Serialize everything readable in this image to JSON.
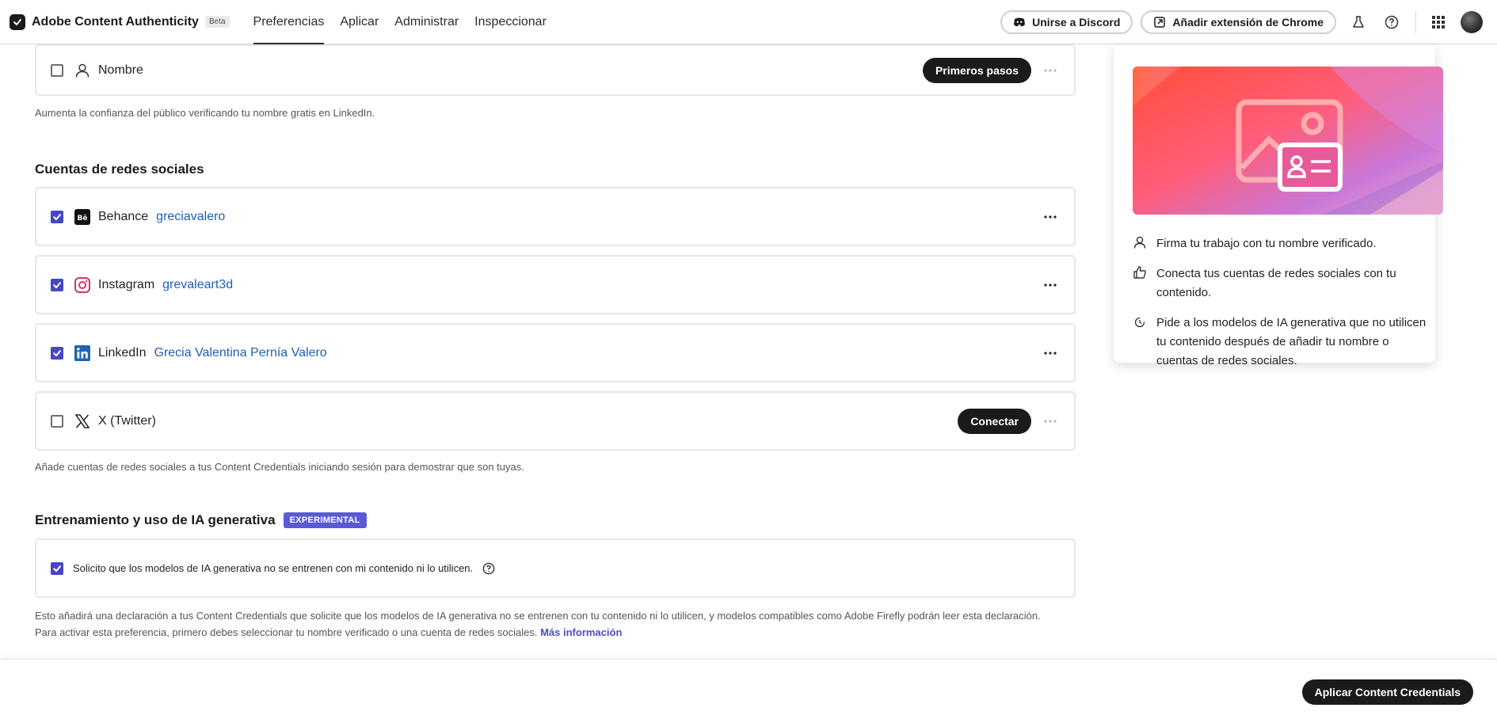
{
  "header": {
    "brand_name": "Adobe Content Authenticity",
    "beta_label": "Beta",
    "nav": [
      {
        "label": "Preferencias",
        "active": true
      },
      {
        "label": "Aplicar"
      },
      {
        "label": "Administrar"
      },
      {
        "label": "Inspeccionar"
      }
    ],
    "discord_label": "Unirse a Discord",
    "chrome_label": "Añadir extensión de Chrome"
  },
  "name_section": {
    "label": "Nombre",
    "start_button": "Primeros pasos",
    "checked": false,
    "helper": "Aumenta la confianza del público verificando tu nombre gratis en LinkedIn."
  },
  "social": {
    "title": "Cuentas de redes sociales",
    "accounts": [
      {
        "service": "Behance",
        "user": "greciavalero",
        "checked": true
      },
      {
        "service": "Instagram",
        "user": "grevaleart3d",
        "checked": true
      },
      {
        "service": "LinkedIn",
        "user": "Grecia Valentina Pernía Valero",
        "checked": true
      },
      {
        "service": "X (Twitter)",
        "connect_button": "Conectar",
        "checked": false
      }
    ],
    "helper": "Añade cuentas de redes sociales a tus Content Credentials iniciando sesión para demostrar que son tuyas."
  },
  "ai": {
    "title": "Entrenamiento y uso de IA generativa",
    "badge": "EXPERIMENTAL",
    "option": "Solicito que los modelos de IA generativa no se entrenen con mi contenido ni lo utilicen.",
    "checked": true,
    "helper": "Esto añadirá una declaración a tus Content Credentials que solicite que los modelos de IA generativa no se entrenen con tu contenido ni lo utilicen, y modelos compatibles como Adobe Firefly podrán leer esta declaración. Para activar esta preferencia, primero debes seleccionar tu nombre verificado o una cuenta de redes sociales.",
    "link": "Más información"
  },
  "panel": {
    "items": [
      "Firma tu trabajo con tu nombre verificado.",
      "Conecta tus cuentas de redes sociales con tu contenido.",
      "Pide a los modelos de IA generativa que no utilicen tu contenido después de añadir tu nombre o cuentas de redes sociales."
    ]
  },
  "footer": {
    "apply_label": "Aplicar Content Credentials"
  },
  "colors": {
    "accent": "#4646c6",
    "link": "#1f5fb8",
    "dark_button": "#1b1b1b",
    "badge": "#5a5ad6"
  }
}
